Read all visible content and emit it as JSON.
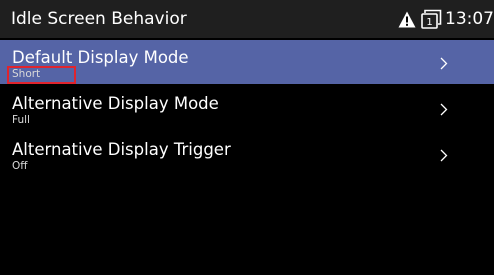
{
  "header": {
    "title": "Idle Screen Behavior",
    "time": "13:07",
    "status_icons": [
      "warning-icon",
      "line-1-icon"
    ],
    "line_number": "1"
  },
  "menu": {
    "items": [
      {
        "label": "Default Display Mode",
        "value": "Short",
        "selected": true,
        "icon": "chevron-right-icon"
      },
      {
        "label": "Alternative Display Mode",
        "value": "Full",
        "selected": false,
        "icon": "chevron-right-icon"
      },
      {
        "label": "Alternative Display Trigger",
        "value": "Off",
        "selected": false,
        "icon": "chevron-right-icon"
      }
    ]
  },
  "colors": {
    "background": "#000000",
    "title_bar": "#1f1f1f",
    "selected_row": "#5564a6",
    "highlight_box": "#e0242e",
    "text": "#ffffff"
  }
}
